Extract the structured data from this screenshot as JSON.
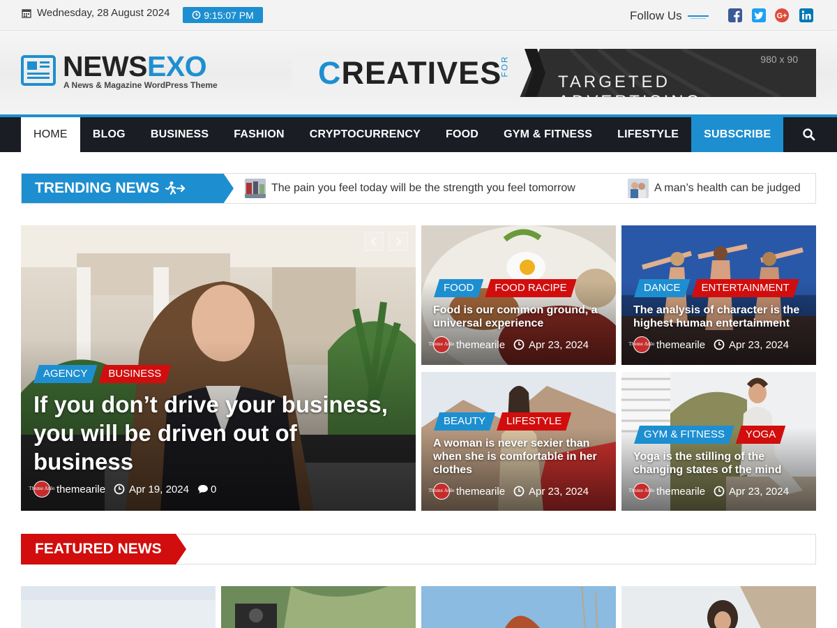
{
  "topbar": {
    "date": "Wednesday, 28 August 2024",
    "time": "9:15:07 PM",
    "follow_label": "Follow Us",
    "social": [
      "facebook-icon",
      "twitter-icon",
      "google-plus-icon",
      "linkedin-icon"
    ]
  },
  "header": {
    "logo_part1": "NEWS",
    "logo_part2": "EXO",
    "tagline": "A News & Magazine WordPress Theme",
    "ad": {
      "word_first": "C",
      "word_rest": "REATIVES",
      "for": "FOR",
      "size": "980 x 90",
      "target": "TARGETED ADVERTISING"
    }
  },
  "nav": {
    "items": [
      "HOME",
      "BLOG",
      "BUSINESS",
      "FASHION",
      "CRYPTOCURRENCY",
      "FOOD",
      "GYM & FITNESS",
      "LIFESTYLE",
      "SUBSCRIBE"
    ]
  },
  "trending": {
    "label": "TRENDING NEWS",
    "items": [
      "The pain you feel today will be the strength you feel tomorrow",
      "A man’s health can be judged"
    ]
  },
  "hero": {
    "tags": [
      "AGENCY",
      "BUSINESS"
    ],
    "title": "If you don’t drive your business, you will be driven out of business",
    "author": "themearile",
    "date": "Apr 19, 2024",
    "comments": "0",
    "avatar_text": "Theme Arile"
  },
  "cards": [
    {
      "tags": [
        "FOOD",
        "FOOD RACIPE"
      ],
      "title": "Food is our common ground, a universal experience",
      "author": "themearile",
      "date": "Apr 23, 2024"
    },
    {
      "tags": [
        "DANCE",
        "ENTERTAINMENT"
      ],
      "title": "The analysis of character is the highest human entertainment",
      "author": "themearile",
      "date": "Apr 23, 2024"
    },
    {
      "tags": [
        "BEAUTY",
        "LIFESTYLE"
      ],
      "title": "A woman is never sexier than when she is comfortable in her clothes",
      "author": "themearile",
      "date": "Apr 23, 2024"
    },
    {
      "tags": [
        "GYM & FITNESS",
        "YOGA"
      ],
      "title": "Yoga is the stilling of the changing states of the mind",
      "author": "themearile",
      "date": "Apr 23, 2024"
    }
  ],
  "featured": {
    "label": "FEATURED NEWS"
  },
  "colors": {
    "accent": "#1d8fd0",
    "tag_red": "#d20d0d",
    "nav_bg": "#1a1d24"
  }
}
